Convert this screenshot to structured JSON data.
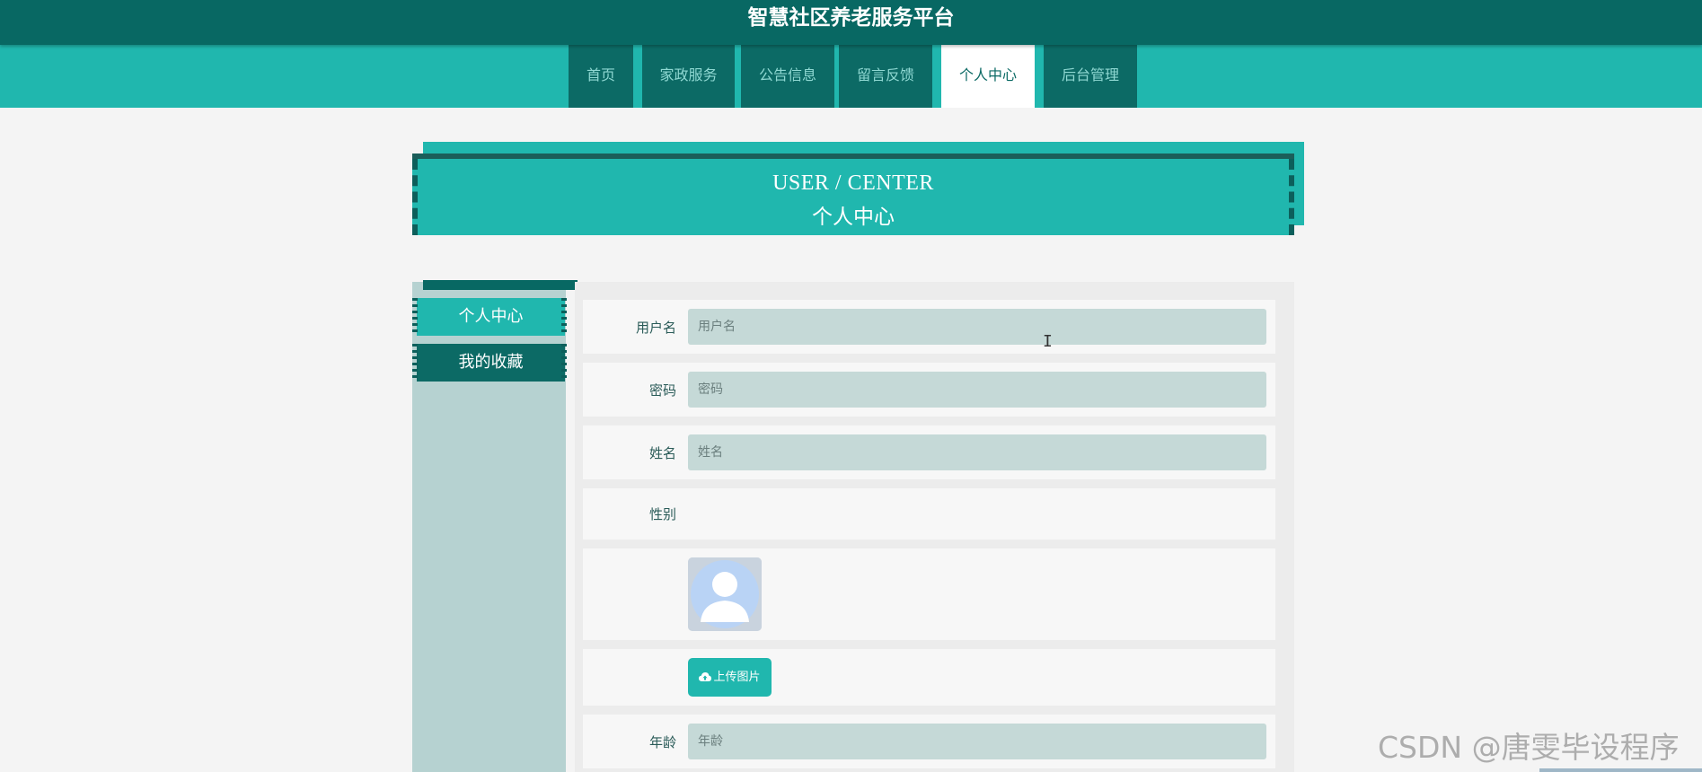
{
  "site_title": "智慧社区养老服务平台",
  "nav": {
    "items": [
      {
        "label": "首页"
      },
      {
        "label": "家政服务"
      },
      {
        "label": "公告信息"
      },
      {
        "label": "留言反馈"
      },
      {
        "label": "个人中心",
        "active": true
      },
      {
        "label": "后台管理"
      }
    ]
  },
  "banner": {
    "en": "USER / CENTER",
    "cn": "个人中心"
  },
  "sidebar": {
    "items": [
      {
        "label": "个人中心",
        "active": true
      },
      {
        "label": "我的收藏"
      }
    ]
  },
  "form": {
    "username": {
      "label": "用户名",
      "placeholder": "用户名",
      "value": ""
    },
    "password": {
      "label": "密码",
      "placeholder": "密码",
      "value": ""
    },
    "name": {
      "label": "姓名",
      "placeholder": "姓名",
      "value": ""
    },
    "gender": {
      "label": "性别"
    },
    "avatar_icon": "default-user-avatar",
    "upload_label": "上传图片",
    "age": {
      "label": "年龄",
      "placeholder": "年龄",
      "value": ""
    }
  },
  "watermark": "CSDN @唐雯毕设程序",
  "colors": {
    "dark_teal": "#086863",
    "teal": "#20b7ae",
    "field_bg": "#c5d9d7",
    "sidebar_bg": "#b6d2d1"
  }
}
